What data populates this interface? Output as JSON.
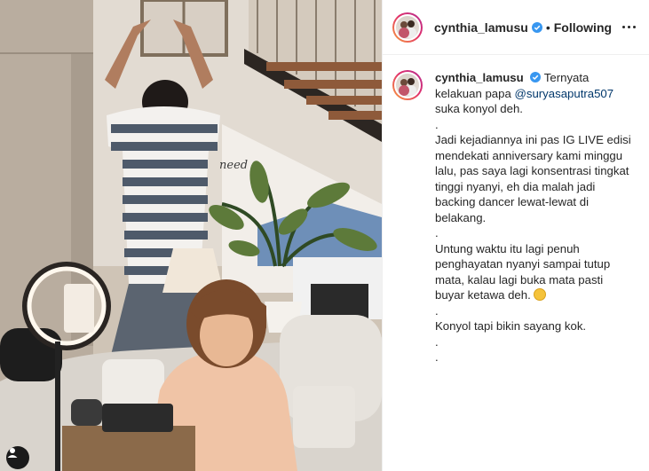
{
  "post": {
    "username": "cynthia_lamusu",
    "dot": "•",
    "follow_state": "Following",
    "caption": {
      "lead": "Ternyata kelakuan papa",
      "mention": "@suryasaputra507",
      "lead_rest": "suka konyol deh.",
      "p1": ".",
      "p2": "Jadi kejadiannya ini pas IG LIVE edisi mendekati anniversary kami minggu lalu, pas saya lagi konsentrasi tingkat tinggi nyanyi, eh dia malah jadi backing dancer lewat-lewat di belakang.",
      "p3": ".",
      "p4": "Untung waktu itu lagi penuh penghayatan nyanyi sampai tutup mata, kalau lagi buka mata pasti buyar ketawa deh.",
      "p5": ".",
      "p6": "Konyol tapi bikin sayang kok.",
      "p7": ".",
      "p8": "."
    },
    "emoji_icon": "rolling-laughing-emoji",
    "verified_icon": "verified-badge-icon",
    "more_icon": "more-options-icon",
    "tag_icon": "user-tag-icon",
    "wall_text": "need"
  },
  "colors": {
    "verified": "#3897f0",
    "mention": "#00376b",
    "text": "#262626",
    "border": "#efefef"
  }
}
